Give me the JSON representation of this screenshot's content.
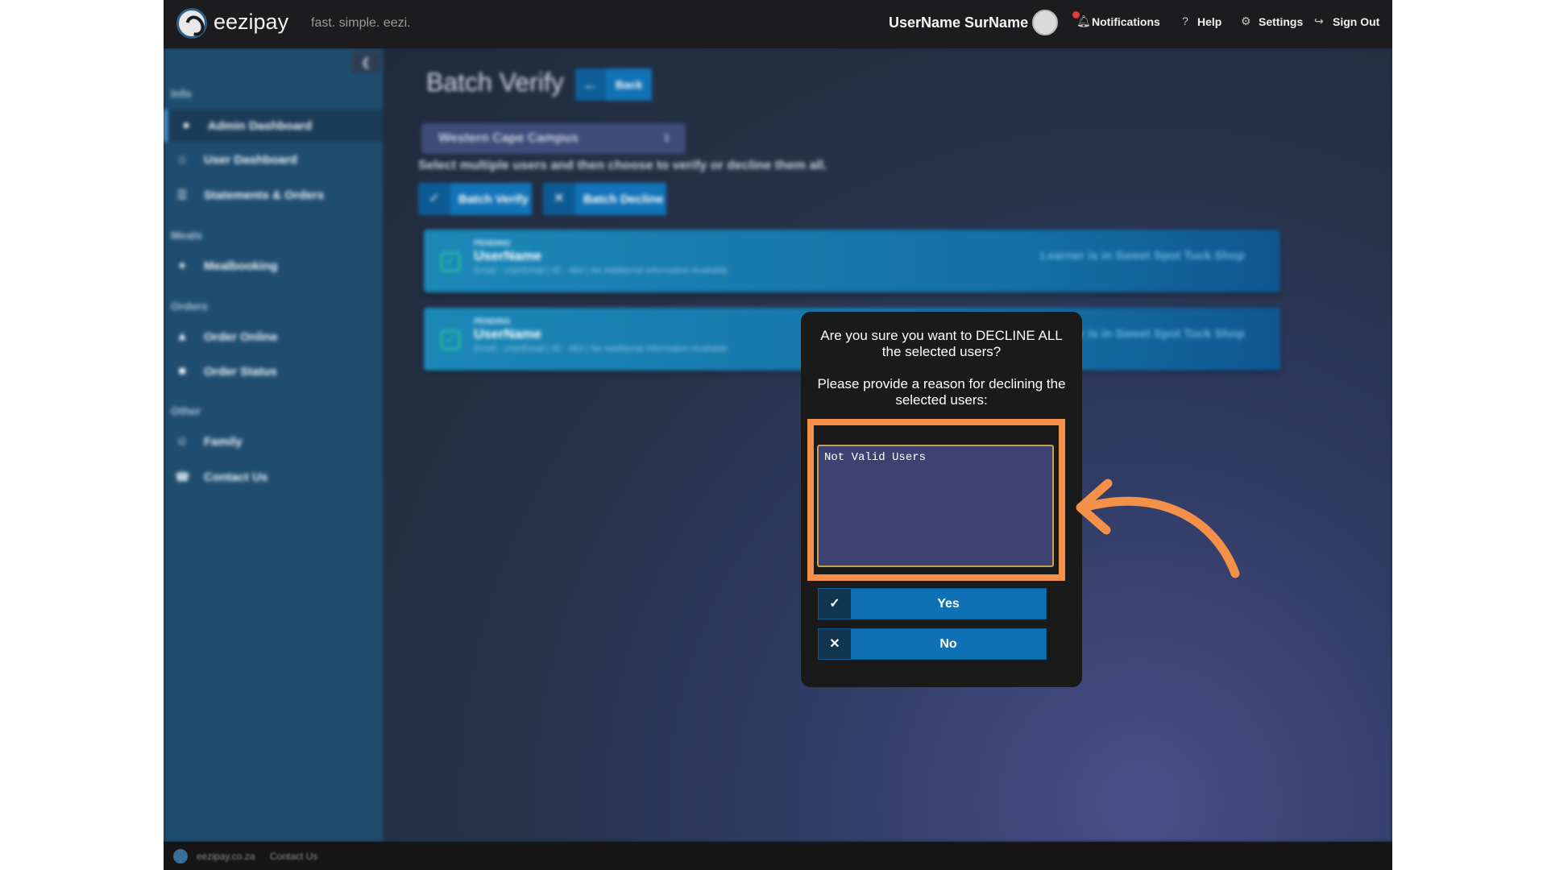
{
  "header": {
    "brand": "eezipay",
    "tagline": "fast. simple. eezi.",
    "user_name": "UserName SurName",
    "links": {
      "notifications": "Notifications",
      "help": "Help",
      "settings": "Settings",
      "sign_out": "Sign Out"
    },
    "icons": {
      "notifications": "bell-icon",
      "help": "question-icon",
      "settings": "gear-icon",
      "sign_out": "sign-out-icon"
    }
  },
  "sidebar": {
    "sections": {
      "info": "Info",
      "meals": "Meals",
      "orders": "Orders",
      "other": "Other"
    },
    "items": {
      "admin_dashboard": "Admin Dashboard",
      "user_dashboard": "User Dashboard",
      "statements_orders": "Statements & Orders",
      "mealbooking": "Mealbooking",
      "order_online": "Order Online",
      "order_status": "Order Status",
      "family": "Family",
      "contact_us": "Contact Us"
    }
  },
  "main": {
    "title": "Batch Verify",
    "back_label": "Back",
    "campus_selected": "Western Cape Campus",
    "instructions": "Select multiple users and then choose to verify or decline them all.",
    "batch_verify_label": "Batch Verify",
    "batch_decline_label": "Batch Decline",
    "users": [
      {
        "status": "PENDING",
        "name": "UserName",
        "meta": "Email - UserEmail | ID - 484 | No Additional Information Available",
        "location": "Learner is in Sweet Spot Tuck Shop"
      },
      {
        "status": "PENDING",
        "name": "UserName",
        "meta": "Email - UserEmail | ID - 483 | No Additional Information Available",
        "location": "Learner is in Sweet Spot Tuck Shop"
      }
    ]
  },
  "modal": {
    "question": "Are you sure you want to DECLINE ALL the selected users?",
    "prompt": "Please provide a reason for declining the selected users:",
    "reason_value": "Not Valid Users",
    "yes_label": "Yes",
    "no_label": "No"
  },
  "footer": {
    "site": "eezipay.co.za",
    "contact": "Contact Us"
  },
  "colors": {
    "annotation": "#f5904a",
    "primary_button": "#0f70b5",
    "sidebar": "#1f4d70"
  }
}
